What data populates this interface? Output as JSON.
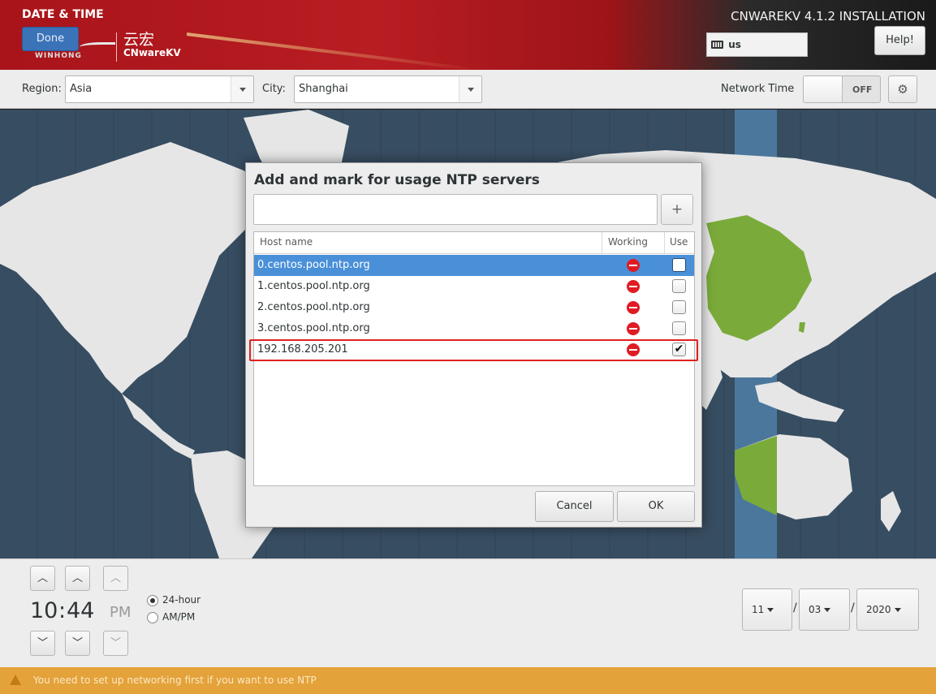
{
  "header": {
    "title": "DATE & TIME",
    "done_label": "Done",
    "logo_brand": "WINHONG",
    "logo_cn": "云宏",
    "logo_en": "CNwareKV",
    "install_title": "CNWAREKV 4.1.2 INSTALLATION",
    "keyboard_layout": "us",
    "help_label": "Help!"
  },
  "toolbar": {
    "region_label": "Region:",
    "region_value": "Asia",
    "city_label": "City:",
    "city_value": "Shanghai",
    "network_time_label": "Network Time",
    "network_time_state": "OFF"
  },
  "time": {
    "hours": "10",
    "separator": ":",
    "minutes": "44",
    "ampm": "PM",
    "format_24h_label": "24-hour",
    "format_ampm_label": "AM/PM",
    "selected_format": "24-hour"
  },
  "date": {
    "month": "11",
    "day": "03",
    "year": "2020",
    "separator": "/"
  },
  "warning": {
    "text": "You need to set up networking first if you want to use NTP"
  },
  "dialog": {
    "title": "Add and mark for usage NTP servers",
    "input_value": "",
    "add_label": "+",
    "columns": {
      "host": "Host name",
      "working": "Working",
      "use": "Use"
    },
    "servers": [
      {
        "host": "0.centos.pool.ntp.org",
        "working": false,
        "use": false,
        "selected": true
      },
      {
        "host": "1.centos.pool.ntp.org",
        "working": false,
        "use": false,
        "selected": false
      },
      {
        "host": "2.centos.pool.ntp.org",
        "working": false,
        "use": false,
        "selected": false
      },
      {
        "host": "3.centos.pool.ntp.org",
        "working": false,
        "use": false,
        "selected": false
      },
      {
        "host": "192.168.205.201",
        "working": false,
        "use": true,
        "selected": false
      }
    ],
    "cancel_label": "Cancel",
    "ok_label": "OK"
  },
  "colors": {
    "header_red": "#b81d22",
    "done_blue": "#3b73b9",
    "selection_blue": "#4a90d9",
    "map_ocean": "#374d61",
    "map_land": "#e6e6e6",
    "map_timezone_highlight": "#4f7fa8",
    "map_selected_land": "#7aab3a",
    "warning_bar": "#e4a23a",
    "highlight_box": "#e02020",
    "not_working_icon": "#e01b24"
  },
  "icons": {
    "keyboard": "keyboard-icon",
    "gear": "gear-icon",
    "warning": "warning-icon",
    "not_working": "no-entry-icon",
    "dropdown": "chevron-down-icon",
    "up": "chevron-up-icon",
    "down": "chevron-down-icon"
  }
}
